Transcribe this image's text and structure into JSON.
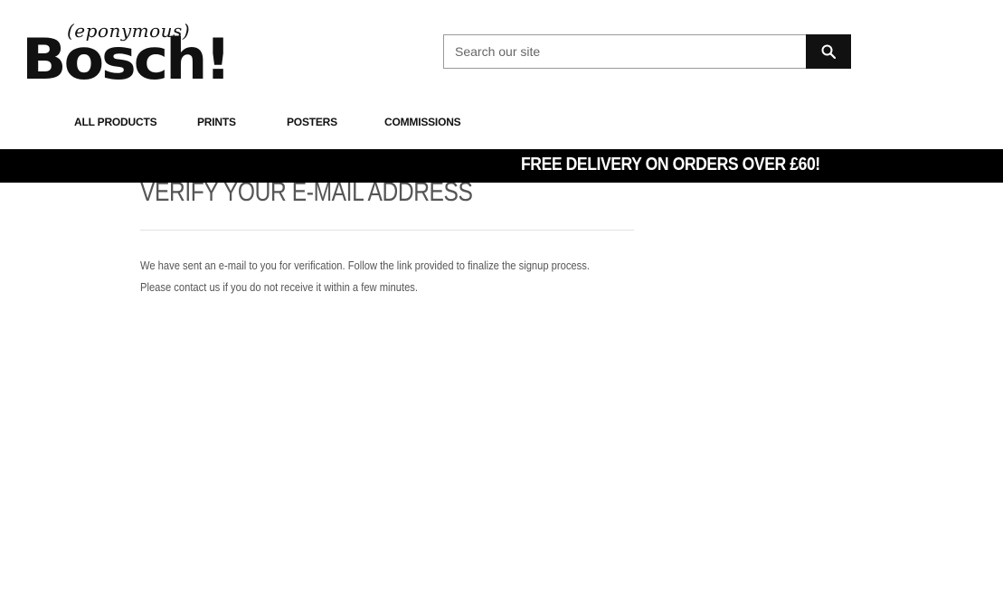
{
  "logo": {
    "script_text": "(eponymous)",
    "main_text": "Bosch!"
  },
  "search": {
    "placeholder": "Search our site",
    "value": ""
  },
  "nav": {
    "items": [
      {
        "label": "ALL PRODUCTS"
      },
      {
        "label": "PRINTS"
      },
      {
        "label": "POSTERS"
      },
      {
        "label": "COMMISSIONS"
      }
    ]
  },
  "banner": {
    "text": "FREE DELIVERY ON ORDERS OVER £60!"
  },
  "main": {
    "title": "VERIFY YOUR E-MAIL ADDRESS",
    "message_line1": "We have sent an e-mail to you for verification. Follow the link provided to finalize the signup process.",
    "message_line2": "Please contact us if you do not receive it within a few minutes."
  },
  "colors": {
    "banner_bg": "#000000",
    "banner_text": "#ffffff",
    "search_button_bg": "#111111"
  },
  "icons": {
    "search_button": "search-icon"
  }
}
